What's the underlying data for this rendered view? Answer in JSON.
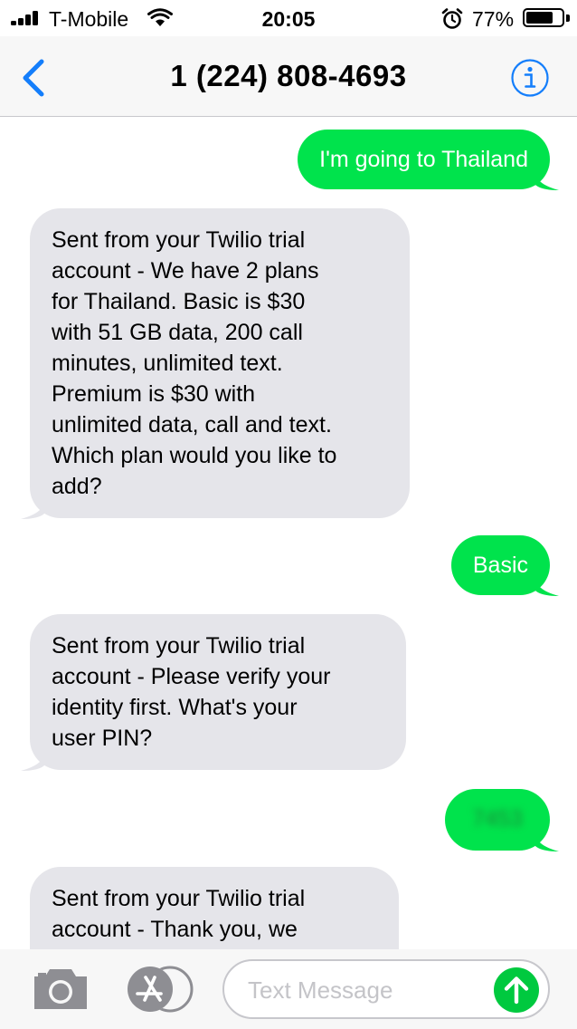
{
  "status_bar": {
    "carrier": "T-Mobile",
    "time": "20:05",
    "battery_percent": "77%",
    "battery_level": 0.77,
    "icons": [
      "signal-icon",
      "wifi-icon",
      "alarm-icon",
      "battery-icon"
    ]
  },
  "nav": {
    "contact": "1 (224) 808-4693",
    "icons": [
      "back-chevron-icon",
      "info-icon"
    ]
  },
  "messages": [
    {
      "direction": "outgoing",
      "text": "I'm going to Thailand"
    },
    {
      "direction": "incoming",
      "lines": [
        "Sent from your Twilio trial",
        "account - We have 2 plans",
        "for Thailand. Basic is $30",
        "with 51 GB data, 200 call",
        "minutes, unlimited text.",
        "Premium is $30 with",
        "unlimited data, call and text.",
        "Which plan would you like to",
        "add?"
      ]
    },
    {
      "direction": "outgoing",
      "text": "Basic"
    },
    {
      "direction": "incoming",
      "lines": [
        "Sent from your Twilio trial",
        "account - Please verify your",
        "identity first. What's your",
        "user PIN?"
      ]
    },
    {
      "direction": "outgoing",
      "text": "7453",
      "blurred": true
    },
    {
      "direction": "incoming",
      "lines": [
        "Sent from your Twilio trial",
        "account - Thank you, we"
      ]
    }
  ],
  "composer": {
    "placeholder": "Text Message",
    "icons": [
      "camera-icon",
      "app-store-icon",
      "send-arrow-icon"
    ]
  },
  "colors": {
    "outgoing_bubble": "#00e34c",
    "incoming_bubble": "#e5e5ea",
    "accent": "#147efb",
    "send_button": "#00c93f"
  }
}
